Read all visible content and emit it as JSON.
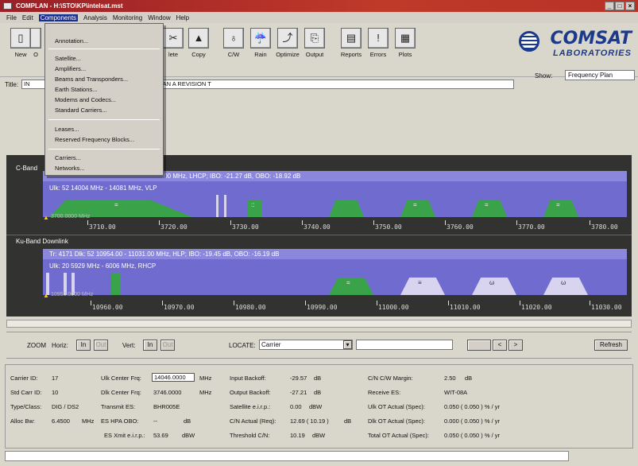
{
  "window": {
    "title": "COMPLAN - H:\\STO\\KP\\intelsat.mst",
    "min": "_",
    "max": "□",
    "close": "×"
  },
  "menu": [
    "File",
    "Edit",
    "Components",
    "Analysis",
    "Monitoring",
    "Window",
    "Help"
  ],
  "components_menu": {
    "group1": [
      "Annotation..."
    ],
    "group2": [
      "Satellite...",
      "Amplifiers...",
      "Beams and Transponders...",
      "Earth Stations...",
      "Modems and Codecs...",
      "Standard Carriers..."
    ],
    "group3": [
      "Leases...",
      "Reserved Frequency Blocks..."
    ],
    "group4": [
      "Carriers...",
      "Networks..."
    ]
  },
  "toolbar": {
    "left_buttons": [
      "New",
      "O"
    ],
    "delete_label": "lete",
    "copy_label": "Copy",
    "cw_label": "C/W",
    "rain_label": "Rain",
    "optimize_label": "Optimize",
    "output_label": "Output",
    "reports_label": "Reports",
    "errors_label": "Errors",
    "plots_label": "Plots"
  },
  "logo": {
    "line1": "COMSAT",
    "line2": "LABORATORIES"
  },
  "title_row": {
    "label": "Title:",
    "value_prefix": "IN",
    "value_suffix": "& 7141 PLAN A REVISION T"
  },
  "show": {
    "label": "Show:",
    "value": "Frequency Plan"
  },
  "cband": {
    "title": "C-Band",
    "beam_top": ".00 MHz, LHCP; IBO: -21.27 dB, OBO: -18.92 dB",
    "beam_sub": "Ulk: 52 14004 MHz - 14081 MHz, VLP",
    "marker": "3700.0000 MHz",
    "ticks": [
      "3710.00",
      "3720.00",
      "3730.00",
      "3740.00",
      "3750.00",
      "3760.00",
      "3770.00",
      "3780.00"
    ],
    "carrier_marks": [
      "=",
      "::",
      "=",
      "=",
      "="
    ]
  },
  "kuband": {
    "title": "Ku-Band Downlink",
    "beam_top": "Tr: 4171 Dlk: 52 10954.00 - 11031.00 MHz, HLP; IBO: -19.45 dB, OBO: -16.19 dB",
    "beam_sub": "Ulk: 20  5929 MHz - 6006 MHz, RHCP",
    "marker": "10950.0000 MHz",
    "ticks": [
      "10960.00",
      "10970.00",
      "10980.00",
      "10990.00",
      "11000.00",
      "11010.00",
      "11020.00",
      "11030.00"
    ],
    "carrier_marks": [
      "=",
      "≡",
      "ω",
      "ω"
    ]
  },
  "zoom": {
    "label": "ZOOM",
    "horiz_label": "Horiz:",
    "vert_label": "Vert:",
    "in_label": "In",
    "out_label": "Out",
    "locate_label": "LOCATE:",
    "locate_value": "Carrier",
    "prev_label": "<",
    "next_label": ">",
    "refresh_label": "Refresh"
  },
  "details": {
    "carrier_id_label": "Carrier ID:",
    "carrier_id": "17",
    "std_carr_label": "Std Carr ID:",
    "std_carr": "10",
    "type_label": "Type/Class:",
    "type": "DIG / DS2",
    "alloc_label": "Alloc Bw:",
    "alloc": "6.4500",
    "alloc_unit": "MHz",
    "ulk_freq_label": "Ulk Center Frq:",
    "ulk_freq": "14046.0000",
    "ulk_unit": "MHz",
    "dlk_freq_label": "Dlk Center Frq:",
    "dlk_freq": "3746.0000",
    "dlk_unit": "MHz",
    "tx_es_label": "Transmit ES:",
    "tx_es": "BHR005E",
    "hpa_label": "ES HPA OBO:",
    "hpa": "--",
    "hpa_unit": "dB",
    "eirp_label": "ES Xmit e.i.r.p.:",
    "eirp": "53.69",
    "eirp_unit": "dBW",
    "ibo_label": "Input Backoff:",
    "ibo": "-29.57",
    "ibo_unit": "dB",
    "obo_label": "Output Backoff:",
    "obo": "-27.21",
    "obo_unit": "dB",
    "sat_eirp_label": "Satellite e.i.r.p.:",
    "sat_eirp": "0.00",
    "sat_eirp_unit": "dBW",
    "cn_label": "C/N Actual (Req):",
    "cn": "12.69 ( 10.19 )",
    "cn_unit": "dB",
    "thr_label": "Threshold C/N:",
    "thr": "10.19",
    "thr_unit": "dBW",
    "margin_label": "C/N C/W Margin:",
    "margin": "2.50",
    "margin_unit": "dB",
    "rx_es_label": "Receive ES:",
    "rx_es": "WIT-08A",
    "ulk_ot_label": "Ulk OT Actual (Spec):",
    "ulk_ot": "0.050 ( 0.050 ) % / yr",
    "dlk_ot_label": "Dlk OT Actual (Spec):",
    "dlk_ot": "0.000 ( 0.050 ) % / yr",
    "tot_ot_label": "Total OT Actual (Spec):",
    "tot_ot": "0.050 ( 0.050 ) % / yr"
  },
  "colors": {
    "plot_bg": "#323330",
    "beam": "#6f6bcf",
    "carrier_green": "#3aa34a",
    "carrier_light": "#d8d4ef"
  }
}
